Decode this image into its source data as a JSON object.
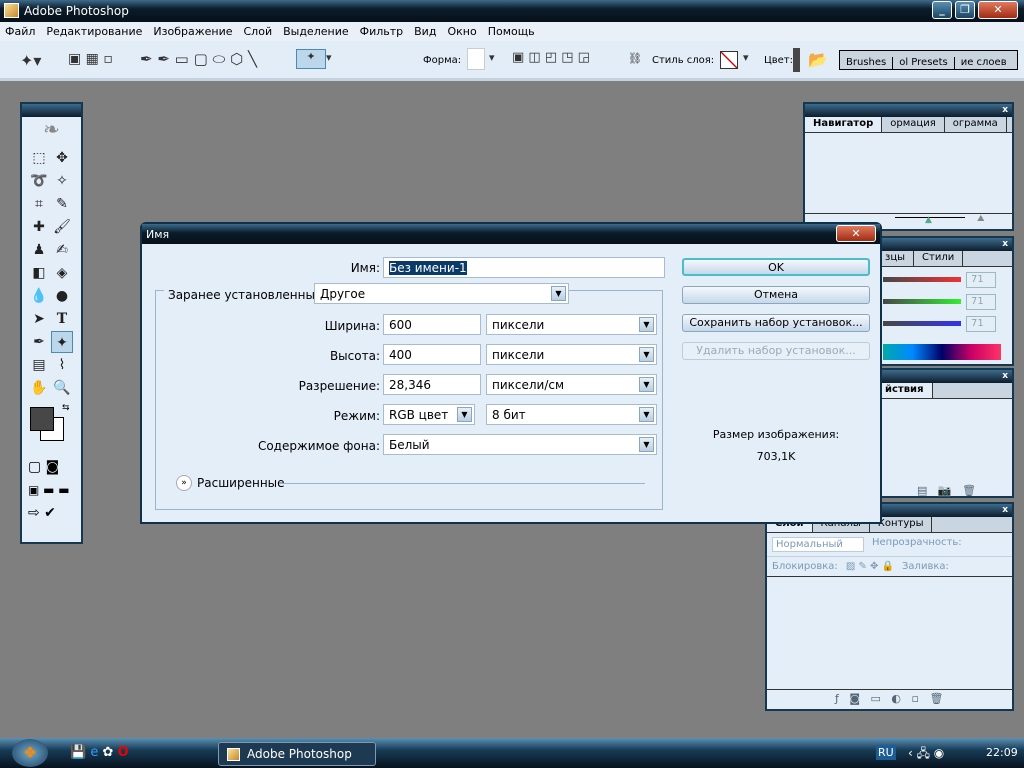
{
  "window": {
    "title": "Adobe Photoshop"
  },
  "menu": [
    "Файл",
    "Редактирование",
    "Изображение",
    "Слой",
    "Выделение",
    "Фильтр",
    "Вид",
    "Окно",
    "Помощь"
  ],
  "options": {
    "shape_label": "Форма:",
    "layer_style_label": "Стиль слоя:",
    "color_label": "Цвет:",
    "palette_tabs": [
      "Brushes",
      "ol Presets",
      "ие слоев"
    ]
  },
  "panels": {
    "navigator": {
      "tabs": [
        "Навигатор",
        "ормация",
        "ограмма"
      ]
    },
    "color": {
      "tabs": [
        "зцы",
        "Стили"
      ],
      "r": "71",
      "g": "71",
      "b": "71"
    },
    "history": {
      "tabs": [
        "йствия"
      ]
    },
    "layers": {
      "tabs": [
        "Слои",
        "Каналы",
        "Контуры"
      ],
      "blend_mode": "Нормальный",
      "opacity_label": "Непрозрачность:",
      "lock_label": "Блокировка:",
      "fill_label": "Заливка:"
    }
  },
  "dialog": {
    "title": "Имя",
    "name_label": "Имя:",
    "name_value": "Без имени-1",
    "preset_label": "Заранее установленные:",
    "preset_value": "Другое",
    "width_label": "Ширина:",
    "width_value": "600",
    "width_unit": "пиксели",
    "height_label": "Высота:",
    "height_value": "400",
    "height_unit": "пиксели",
    "resolution_label": "Разрешение:",
    "resolution_value": "28,346",
    "resolution_unit": "пиксели/см",
    "mode_label": "Режим:",
    "mode_value": "RGB цвет",
    "depth_value": "8 бит",
    "background_label": "Содержимое фона:",
    "background_value": "Белый",
    "advanced_label": "Расширенные",
    "ok": "OK",
    "cancel": "Отмена",
    "save_preset": "Сохранить набор установок...",
    "delete_preset": "Удалить набор установок...",
    "size_label": "Размер изображения:",
    "size_value": "703,1K"
  },
  "taskbar": {
    "task": "Adobe Photoshop",
    "lang": "RU",
    "clock": "22:09"
  }
}
